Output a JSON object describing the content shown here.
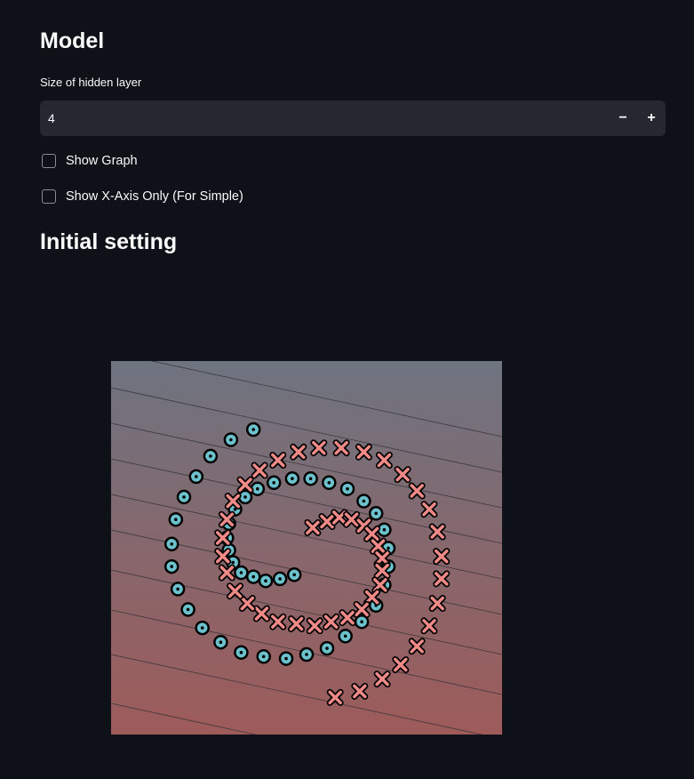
{
  "model_section": {
    "title": "Model",
    "hidden_layer": {
      "label": "Size of hidden layer",
      "value": "4",
      "decrement": "−",
      "increment": "+"
    },
    "show_graph": {
      "label": "Show Graph",
      "checked": false
    },
    "show_x_axis": {
      "label": "Show X-Axis Only (For Simple)",
      "checked": false
    }
  },
  "initial_section": {
    "title": "Initial setting"
  },
  "colors": {
    "background": "#0e1117",
    "input_bg": "#262730",
    "class_circle": "#6cc2cc",
    "class_cross": "#f08a87",
    "plot_top": "#6e7480",
    "plot_bottom": "#9e5b5a"
  },
  "chart_data": {
    "type": "scatter",
    "title": "",
    "xlabel": "",
    "ylabel": "",
    "series": [
      {
        "marker": "circle",
        "points": [
          [
            -0.06,
            -0.11
          ],
          [
            -0.13,
            -0.13
          ],
          [
            -0.2,
            -0.14
          ],
          [
            -0.26,
            -0.12
          ],
          [
            -0.32,
            -0.1
          ],
          [
            -0.36,
            -0.05
          ],
          [
            -0.38,
            0.01
          ],
          [
            -0.39,
            0.07
          ],
          [
            -0.38,
            0.14
          ],
          [
            -0.35,
            0.21
          ],
          [
            -0.3,
            0.27
          ],
          [
            -0.24,
            0.31
          ],
          [
            -0.16,
            0.34
          ],
          [
            -0.07,
            0.36
          ],
          [
            0.02,
            0.36
          ],
          [
            0.11,
            0.34
          ],
          [
            0.2,
            0.31
          ],
          [
            0.28,
            0.25
          ],
          [
            0.34,
            0.19
          ],
          [
            0.38,
            0.11
          ],
          [
            0.4,
            0.02
          ],
          [
            0.4,
            -0.07
          ],
          [
            0.38,
            -0.16
          ],
          [
            0.34,
            -0.26
          ],
          [
            0.27,
            -0.34
          ],
          [
            0.19,
            -0.41
          ],
          [
            0.1,
            -0.47
          ],
          [
            0.0,
            -0.5
          ],
          [
            -0.1,
            -0.52
          ],
          [
            -0.21,
            -0.51
          ],
          [
            -0.32,
            -0.49
          ],
          [
            -0.42,
            -0.44
          ],
          [
            -0.51,
            -0.37
          ],
          [
            -0.58,
            -0.28
          ],
          [
            -0.63,
            -0.18
          ],
          [
            -0.66,
            -0.07
          ],
          [
            -0.66,
            0.04
          ],
          [
            -0.64,
            0.16
          ],
          [
            -0.6,
            0.27
          ],
          [
            -0.54,
            0.37
          ],
          [
            -0.47,
            0.47
          ],
          [
            -0.37,
            0.55
          ],
          [
            -0.26,
            0.6
          ]
        ]
      },
      {
        "marker": "cross",
        "points": [
          [
            0.03,
            0.12
          ],
          [
            0.1,
            0.15
          ],
          [
            0.16,
            0.17
          ],
          [
            0.22,
            0.16
          ],
          [
            0.28,
            0.13
          ],
          [
            0.32,
            0.09
          ],
          [
            0.35,
            0.03
          ],
          [
            0.37,
            -0.03
          ],
          [
            0.37,
            -0.09
          ],
          [
            0.36,
            -0.16
          ],
          [
            0.32,
            -0.22
          ],
          [
            0.27,
            -0.28
          ],
          [
            0.2,
            -0.32
          ],
          [
            0.12,
            -0.34
          ],
          [
            0.04,
            -0.36
          ],
          [
            -0.05,
            -0.35
          ],
          [
            -0.14,
            -0.34
          ],
          [
            -0.22,
            -0.3
          ],
          [
            -0.29,
            -0.25
          ],
          [
            -0.35,
            -0.19
          ],
          [
            -0.39,
            -0.1
          ],
          [
            -0.41,
            -0.02
          ],
          [
            -0.41,
            0.07
          ],
          [
            -0.39,
            0.16
          ],
          [
            -0.36,
            0.25
          ],
          [
            -0.3,
            0.33
          ],
          [
            -0.23,
            0.4
          ],
          [
            -0.14,
            0.45
          ],
          [
            -0.04,
            0.49
          ],
          [
            0.06,
            0.51
          ],
          [
            0.17,
            0.51
          ],
          [
            0.28,
            0.49
          ],
          [
            0.38,
            0.45
          ],
          [
            0.47,
            0.38
          ],
          [
            0.54,
            0.3
          ],
          [
            0.6,
            0.21
          ],
          [
            0.64,
            0.1
          ],
          [
            0.66,
            -0.02
          ],
          [
            0.66,
            -0.13
          ],
          [
            0.64,
            -0.25
          ],
          [
            0.6,
            -0.36
          ],
          [
            0.54,
            -0.46
          ],
          [
            0.46,
            -0.55
          ],
          [
            0.37,
            -0.62
          ],
          [
            0.26,
            -0.68
          ],
          [
            0.14,
            -0.71
          ]
        ]
      }
    ],
    "contours": true
  }
}
